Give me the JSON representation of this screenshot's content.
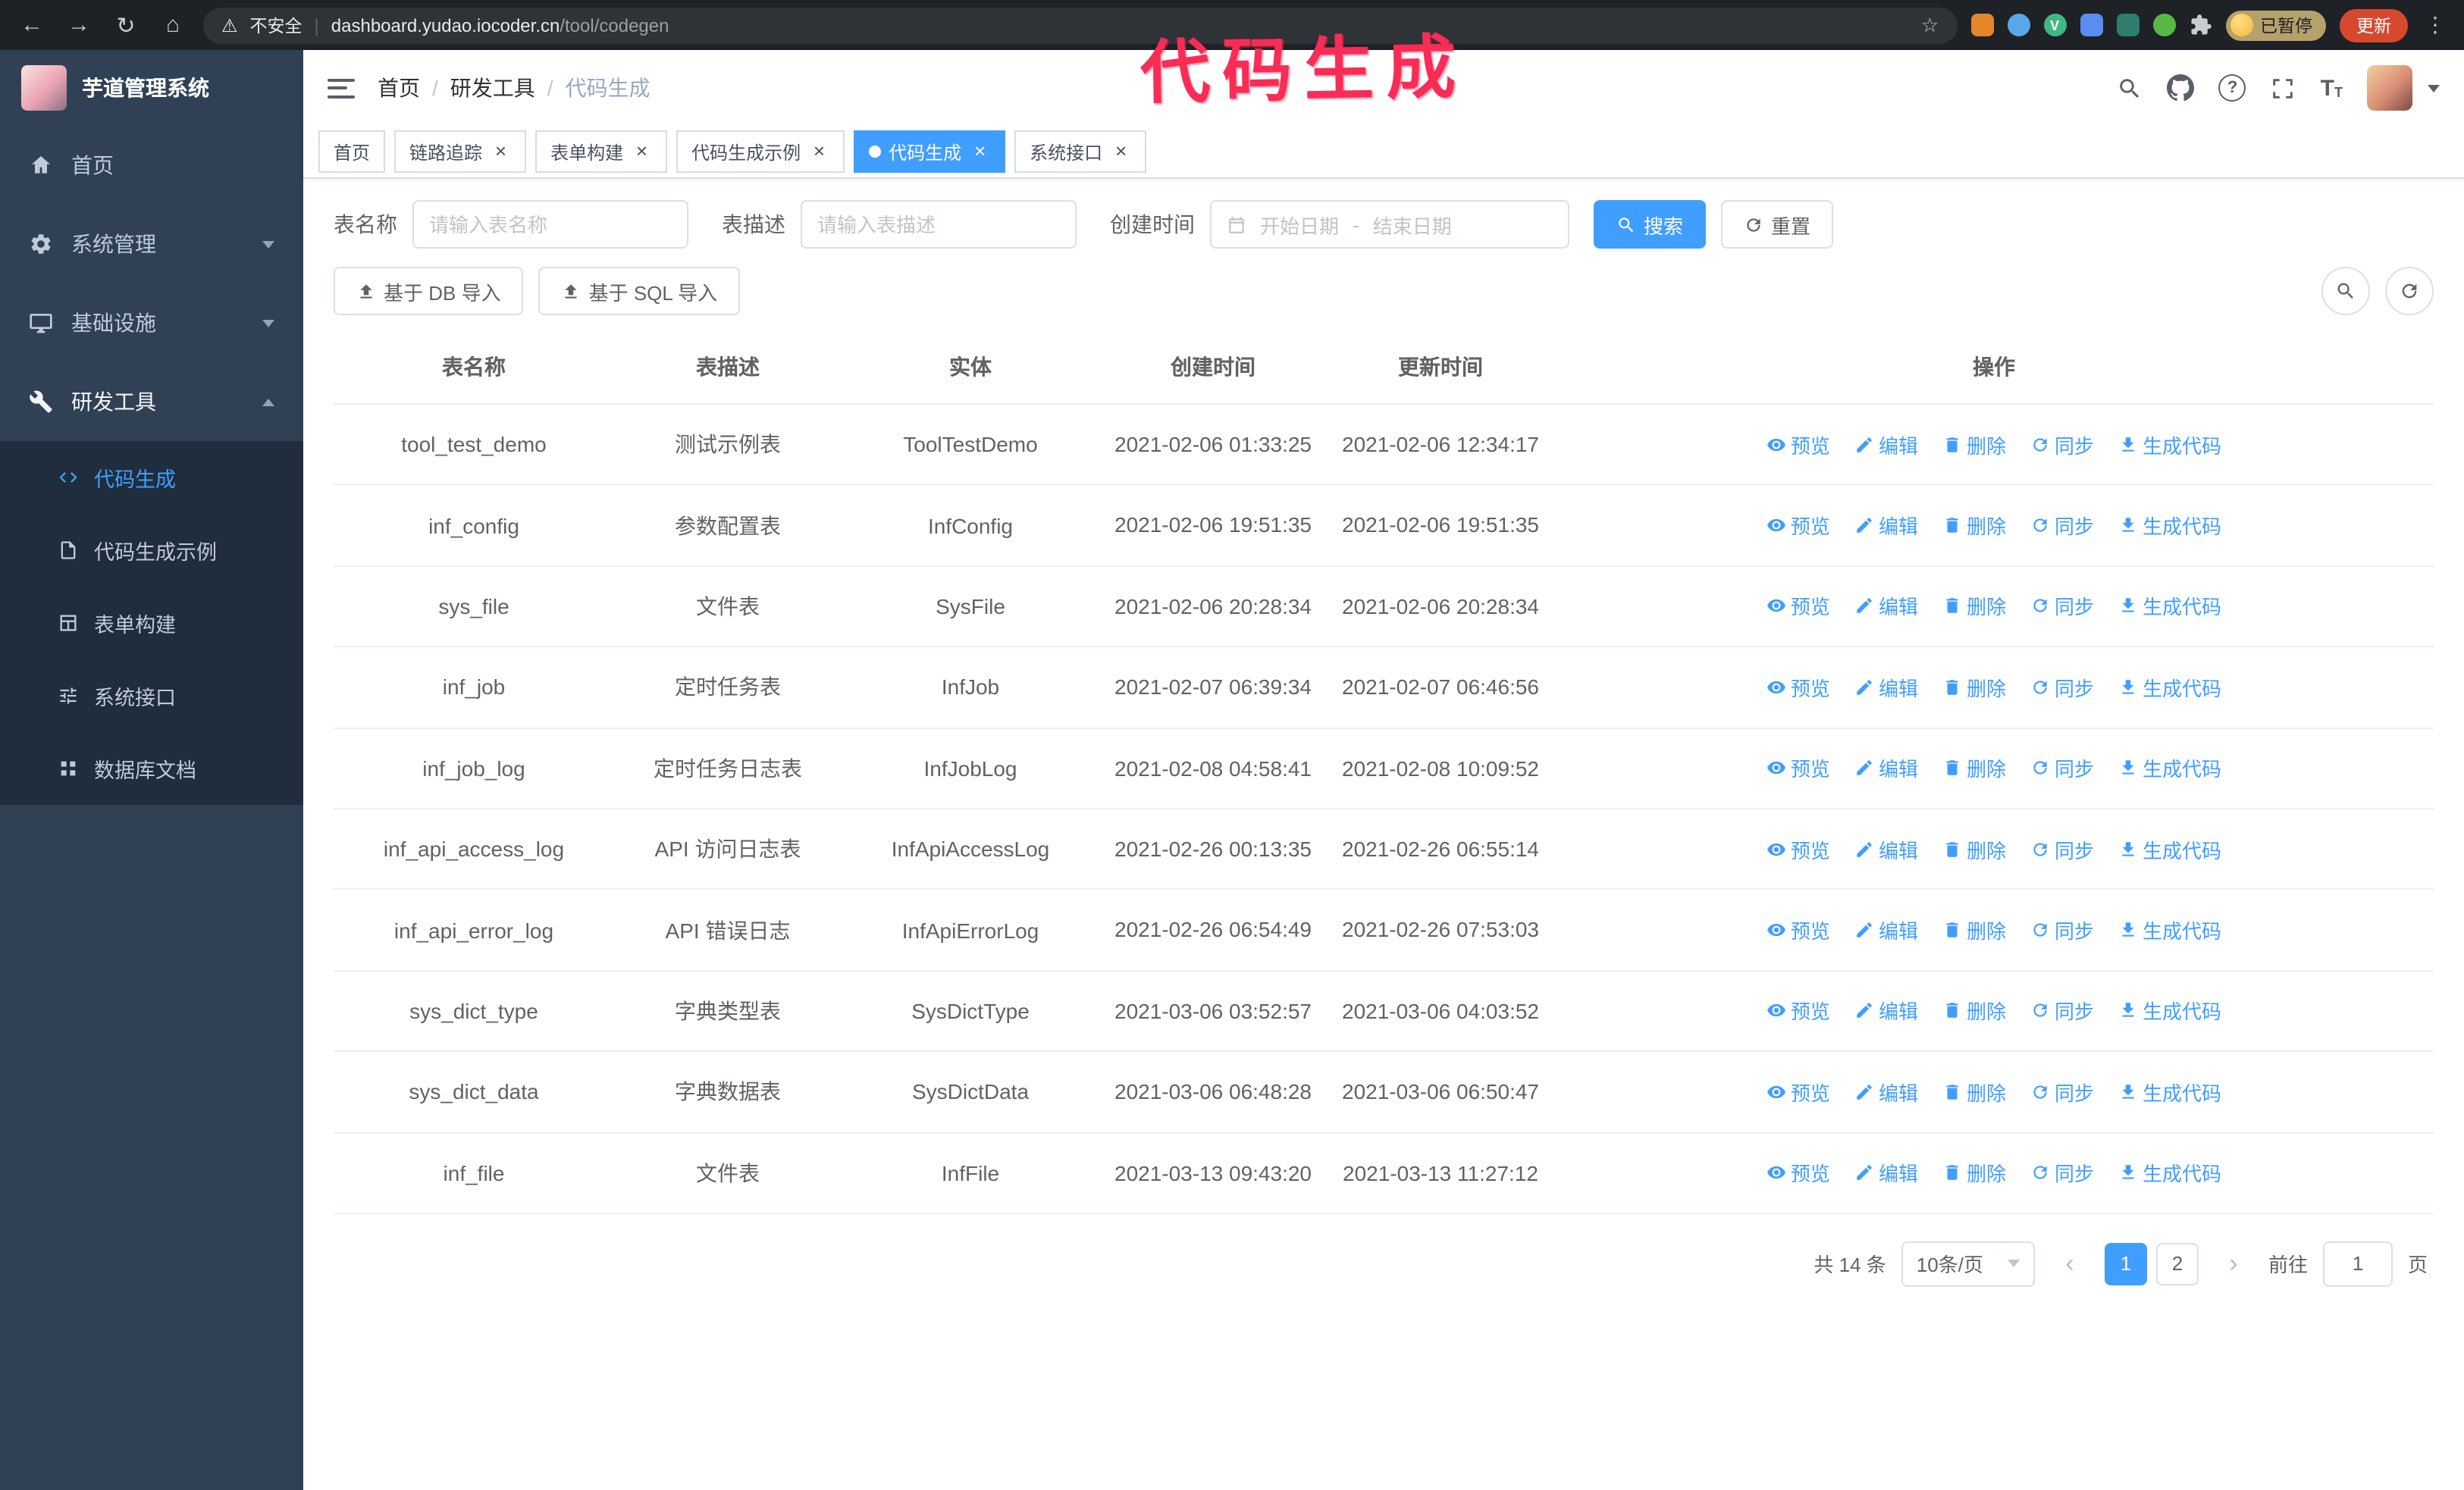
{
  "browser": {
    "security_label": "不安全",
    "url_host": "dashboard.yudao.iocoder.cn",
    "url_path": "/tool/codegen",
    "profile_badge": "已暂停",
    "update_button": "更新"
  },
  "annotation": "代码生成",
  "sidebar": {
    "logo_title": "芋道管理系统",
    "items": [
      {
        "label": "首页"
      },
      {
        "label": "系统管理"
      },
      {
        "label": "基础设施"
      },
      {
        "label": "研发工具"
      }
    ],
    "subitems": [
      {
        "label": "代码生成",
        "active": true
      },
      {
        "label": "代码生成示例",
        "active": false
      },
      {
        "label": "表单构建",
        "active": false
      },
      {
        "label": "系统接口",
        "active": false
      },
      {
        "label": "数据库文档",
        "active": false
      }
    ]
  },
  "breadcrumb": [
    "首页",
    "研发工具",
    "代码生成"
  ],
  "tabs": [
    {
      "label": "首页",
      "closable": false,
      "active": false
    },
    {
      "label": "链路追踪",
      "closable": true,
      "active": false
    },
    {
      "label": "表单构建",
      "closable": true,
      "active": false
    },
    {
      "label": "代码生成示例",
      "closable": true,
      "active": false
    },
    {
      "label": "代码生成",
      "closable": true,
      "active": true
    },
    {
      "label": "系统接口",
      "closable": true,
      "active": false
    }
  ],
  "filters": {
    "table_name_label": "表名称",
    "table_name_placeholder": "请输入表名称",
    "table_desc_label": "表描述",
    "table_desc_placeholder": "请输入表描述",
    "create_time_label": "创建时间",
    "date_start_placeholder": "开始日期",
    "date_separator": "-",
    "date_end_placeholder": "结束日期",
    "search_button": "搜索",
    "reset_button": "重置"
  },
  "toolbar": {
    "import_db_button": "基于 DB 导入",
    "import_sql_button": "基于 SQL 导入"
  },
  "table": {
    "columns": [
      "表名称",
      "表描述",
      "实体",
      "创建时间",
      "更新时间",
      "操作"
    ],
    "actions": [
      {
        "key": "preview",
        "label": "预览"
      },
      {
        "key": "edit",
        "label": "编辑"
      },
      {
        "key": "delete",
        "label": "删除"
      },
      {
        "key": "sync",
        "label": "同步"
      },
      {
        "key": "generate",
        "label": "生成代码"
      }
    ],
    "rows": [
      {
        "name": "tool_test_demo",
        "desc": "测试示例表",
        "entity": "ToolTestDemo",
        "created": "2021-02-06 01:33:25",
        "updated": "2021-02-06 12:34:17"
      },
      {
        "name": "inf_config",
        "desc": "参数配置表",
        "entity": "InfConfig",
        "created": "2021-02-06 19:51:35",
        "updated": "2021-02-06 19:51:35"
      },
      {
        "name": "sys_file",
        "desc": "文件表",
        "entity": "SysFile",
        "created": "2021-02-06 20:28:34",
        "updated": "2021-02-06 20:28:34"
      },
      {
        "name": "inf_job",
        "desc": "定时任务表",
        "entity": "InfJob",
        "created": "2021-02-07 06:39:34",
        "updated": "2021-02-07 06:46:56"
      },
      {
        "name": "inf_job_log",
        "desc": "定时任务日志表",
        "entity": "InfJobLog",
        "created": "2021-02-08 04:58:41",
        "updated": "2021-02-08 10:09:52"
      },
      {
        "name": "inf_api_access_log",
        "desc": "API 访问日志表",
        "entity": "InfApiAccessLog",
        "created": "2021-02-26 00:13:35",
        "updated": "2021-02-26 06:55:14"
      },
      {
        "name": "inf_api_error_log",
        "desc": "API 错误日志",
        "entity": "InfApiErrorLog",
        "created": "2021-02-26 06:54:49",
        "updated": "2021-02-26 07:53:03"
      },
      {
        "name": "sys_dict_type",
        "desc": "字典类型表",
        "entity": "SysDictType",
        "created": "2021-03-06 03:52:57",
        "updated": "2021-03-06 04:03:52"
      },
      {
        "name": "sys_dict_data",
        "desc": "字典数据表",
        "entity": "SysDictData",
        "created": "2021-03-06 06:48:28",
        "updated": "2021-03-06 06:50:47"
      },
      {
        "name": "inf_file",
        "desc": "文件表",
        "entity": "InfFile",
        "created": "2021-03-13 09:43:20",
        "updated": "2021-03-13 11:27:12"
      }
    ]
  },
  "pagination": {
    "total_label": "共 14 条",
    "page_size_label": "10条/页",
    "pages": [
      "1",
      "2"
    ],
    "active_page": "1",
    "goto_prefix": "前往",
    "goto_value": "1",
    "goto_suffix": "页"
  },
  "colors": {
    "accent": "#409eff",
    "annotation": "#f92c55",
    "sidebar_bg": "#304156",
    "submenu_bg": "#1f2d3d"
  }
}
